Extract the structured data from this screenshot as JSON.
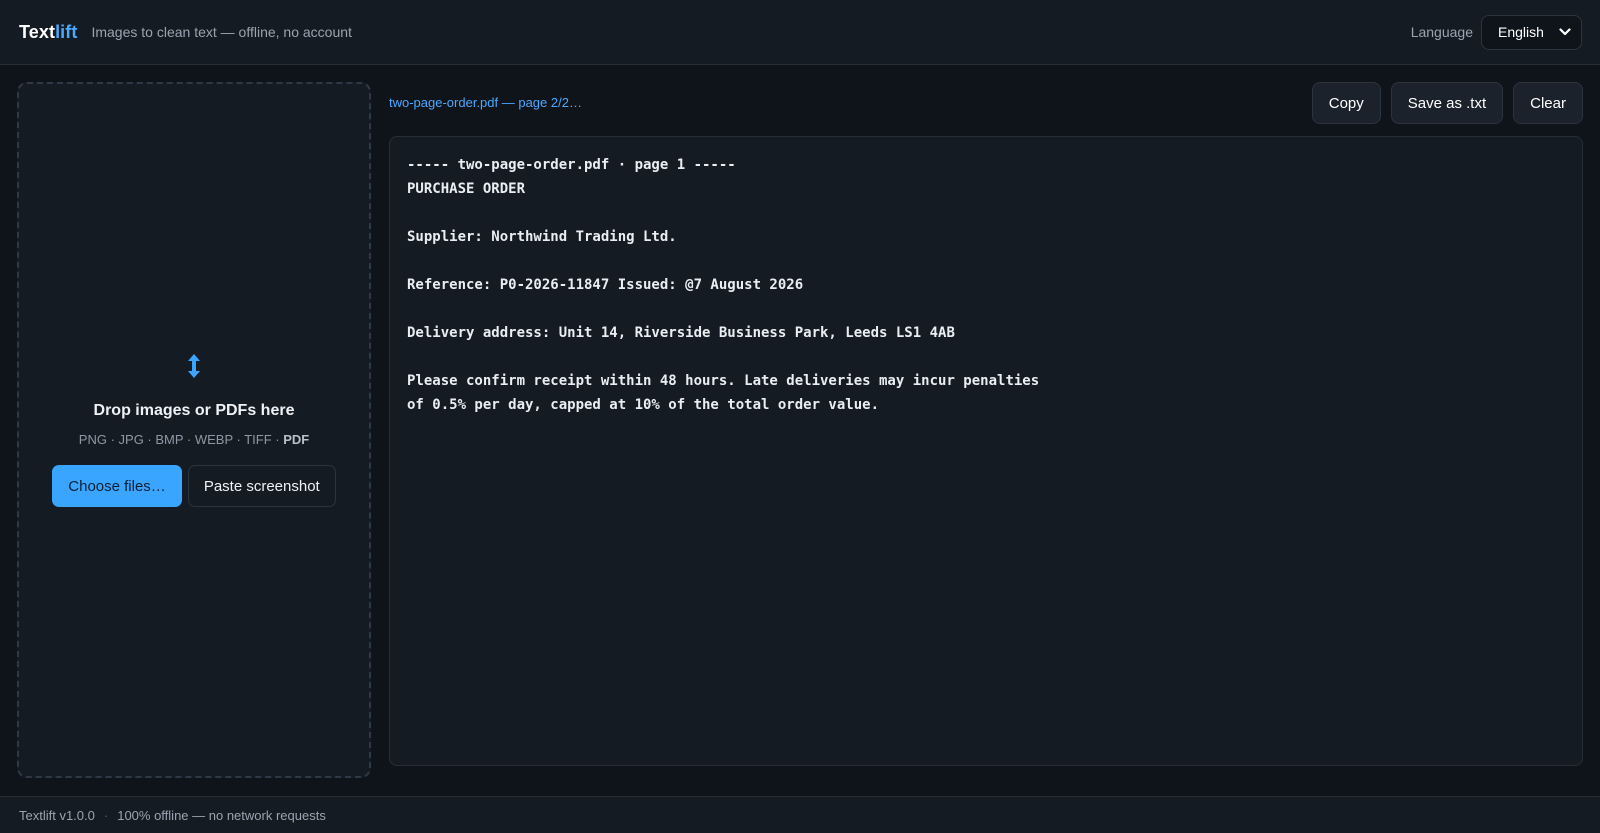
{
  "header": {
    "brand_part1": "Text",
    "brand_part2": "lift",
    "tagline": "Images to clean text — offline, no account",
    "language_label": "Language",
    "language_value": "English"
  },
  "dropzone": {
    "icon": "upload-arrows-icon",
    "title": "Drop images or PDFs here",
    "formats": "PNG · JPG · BMP · WEBP · TIFF · ",
    "formats_pdf": "PDF",
    "choose_button": "Choose files…",
    "paste_button": "Paste screenshot"
  },
  "toolbar": {
    "status": "two-page-order.pdf — page 2/2…",
    "copy": "Copy",
    "save": "Save as .txt",
    "clear": "Clear"
  },
  "output": {
    "lines": [
      "----- two-page-order.pdf · page 1 -----",
      "PURCHASE ORDER",
      "",
      "Supplier: Northwind Trading Ltd.",
      "",
      "Reference: P0-2026-11847 Issued: @7 August 2026",
      "",
      "Delivery address: Unit 14, Riverside Business Park, Leeds LS1 4AB",
      "",
      "Please confirm receipt within 48 hours. Late deliveries may incur penalties",
      "of 0.5% per day, capped at 10% of the total order value."
    ]
  },
  "footer": {
    "version": "Textlift v1.0.0",
    "separator": "·",
    "status": "100% offline — no network requests"
  },
  "colors": {
    "accent": "#3aa5ff",
    "background": "#0f141a",
    "panel": "#151b22"
  }
}
